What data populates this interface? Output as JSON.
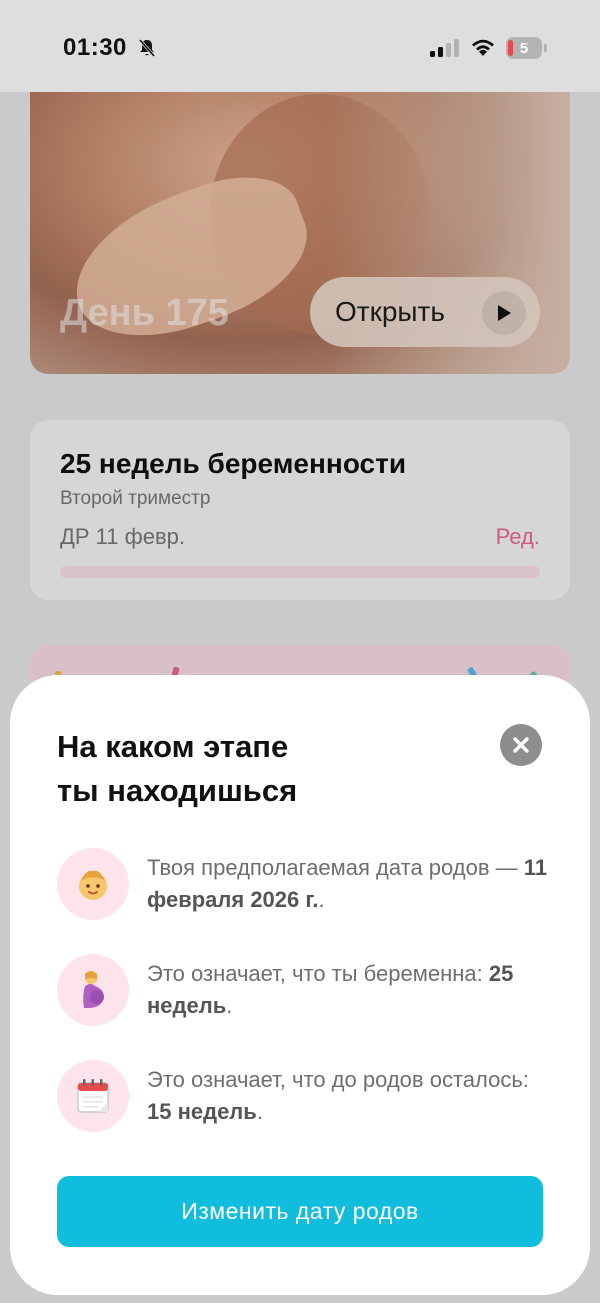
{
  "status_bar": {
    "time": "01:30",
    "battery": "5"
  },
  "hero": {
    "day_label": "День 175",
    "open_label": "Открыть"
  },
  "week_card": {
    "title": "25 недель беременности",
    "subtitle": "Второй триместр",
    "due_label": "ДР 11 февр.",
    "edit_label": "Ред.",
    "progress": 0.0
  },
  "sheet": {
    "title_line1": "На каком этапе",
    "title_line2": "ты находишься",
    "rows": [
      {
        "icon": "baby-face-icon",
        "text": "Твоя предполагаемая дата родов — ",
        "bold": "11 февраля 2026 г.",
        "suffix": "."
      },
      {
        "icon": "pregnant-woman-icon",
        "text": "Это означает, что ты беременна: ",
        "bold": "25 недель",
        "suffix": "."
      },
      {
        "icon": "calendar-icon",
        "text": "Это означает, что до родов осталось: ",
        "bold": "15 недель",
        "suffix": "."
      }
    ],
    "button_label": "Изменить дату родов"
  },
  "colors": {
    "accent": "#11bddc",
    "edit_link": "#e86a8e",
    "icon_bg": "#fde4ea"
  }
}
